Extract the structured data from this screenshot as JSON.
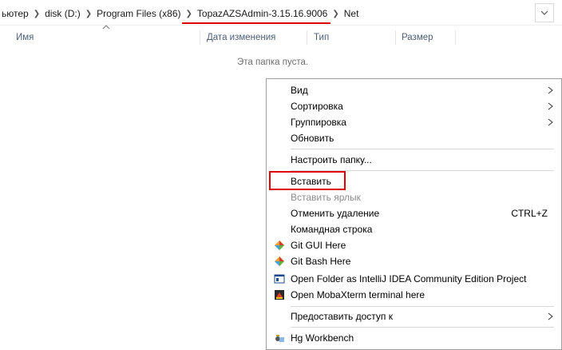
{
  "breadcrumb": {
    "items": [
      "ьютер",
      "disk (D:)",
      "Program Files (x86)",
      "TopazAZSAdmin-3.15.16.9006",
      "Net"
    ]
  },
  "columns": {
    "name": "Имя",
    "date": "Дата изменения",
    "type": "Тип",
    "size": "Размер"
  },
  "empty_text": "Эта папка пуста.",
  "menu": {
    "view": "Вид",
    "sort": "Сортировка",
    "group": "Группировка",
    "refresh": "Обновить",
    "customize": "Настроить папку...",
    "paste": "Вставить",
    "paste_shortcut": "Вставить ярлык",
    "undo": "Отменить удаление",
    "undo_shortcut": "CTRL+Z",
    "cmd": "Командная строка",
    "git_gui": "Git GUI Here",
    "git_bash": "Git Bash Here",
    "intellij": "Open Folder as IntelliJ IDEA Community Edition Project",
    "mobaxterm": "Open MobaXterm terminal here",
    "share": "Предоставить доступ к",
    "hg": "Hg Workbench"
  },
  "colors": {
    "highlight_red": "#e00000",
    "header_text": "#4c607a",
    "disabled_text": "#8c8c8c"
  },
  "icons": {
    "git_gui": "git-diamond-icon",
    "git_bash": "git-diamond-icon",
    "intellij": "intellij-window-icon",
    "mobaxterm": "mobaxterm-icon",
    "hg": "hg-workbench-icon"
  }
}
